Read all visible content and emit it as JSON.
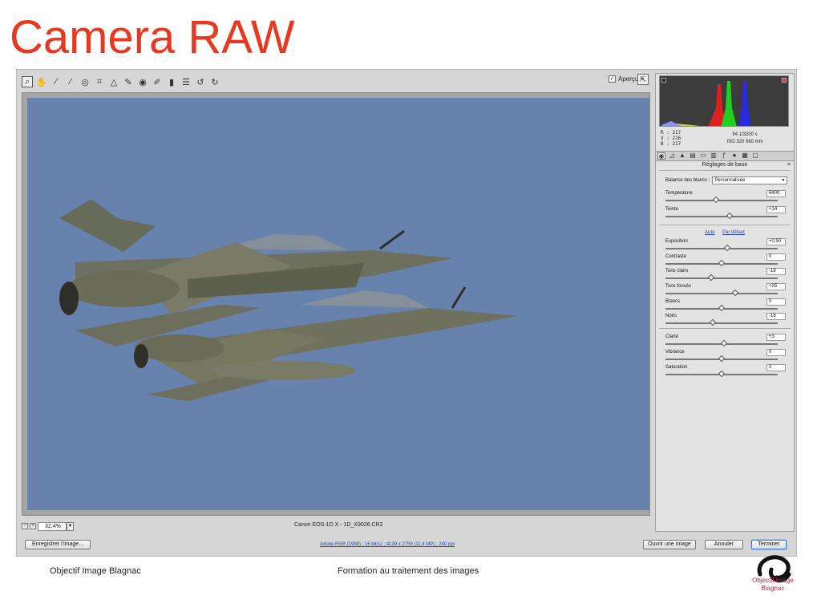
{
  "slide": {
    "title": "Camera RAW",
    "footer_left": "Objectif Image Blagnac",
    "footer_center": "Formation au traitement des images",
    "logo_line1": "Objectif Image",
    "logo_line2": "Blagnac"
  },
  "toolbar": {
    "tools": [
      "zoom-icon",
      "hand-icon",
      "white-balance-icon",
      "color-sampler-icon",
      "target-adjust-icon",
      "crop-icon",
      "straighten-icon",
      "spot-removal-icon",
      "red-eye-icon",
      "adjustment-brush-icon",
      "graduated-filter-icon",
      "preferences-icon",
      "rotate-ccw-icon",
      "rotate-cw-icon"
    ],
    "preview_label": "Aperçu",
    "preview_checked": true
  },
  "status": {
    "zoom_value": "32.4%",
    "file_name": "Canon EOS-1D X  -  1D_X9026.CR2"
  },
  "readout": {
    "r": "R :  217",
    "v": "V :  216",
    "b": "B :  217",
    "aperture_shutter": "f/4   1/3200 s",
    "iso_focal": "ISO 320    560 mm"
  },
  "panel": {
    "heading": "Réglages de base",
    "wb_label": "Balance des blancs :",
    "wb_value": "Personnalisée",
    "auto_label": "Auto",
    "default_label": "Par défaut",
    "controls": [
      {
        "label": "Température",
        "value": "6400",
        "pos": 0.45
      },
      {
        "label": "Teinte",
        "value": "+14",
        "pos": 0.57
      },
      {
        "label": "Exposition",
        "value": "+0,50",
        "pos": 0.55
      },
      {
        "label": "Contraste",
        "value": "0",
        "pos": 0.5
      },
      {
        "label": "Tons clairs",
        "value": "-18",
        "pos": 0.41
      },
      {
        "label": "Tons foncés",
        "value": "+25",
        "pos": 0.62
      },
      {
        "label": "Blancs",
        "value": "0",
        "pos": 0.5
      },
      {
        "label": "Noirs",
        "value": "-16",
        "pos": 0.42
      },
      {
        "label": "Clarté",
        "value": "+3",
        "pos": 0.52
      },
      {
        "label": "Vibrance",
        "value": "0",
        "pos": 0.5
      },
      {
        "label": "Saturation",
        "value": "0",
        "pos": 0.5
      }
    ]
  },
  "buttons": {
    "save": "Enregistrer l'image...",
    "workflow": "Adobe RGB (1998) ; 16 bit(s) ; 4139 x 2759 (11,4 MP) ; 240 ppi",
    "open": "Ouvrir une image",
    "cancel": "Annuler",
    "done": "Terminer"
  },
  "colors": {
    "title": "#e8381f",
    "sky": "#6782ac",
    "link": "#2242b8"
  }
}
